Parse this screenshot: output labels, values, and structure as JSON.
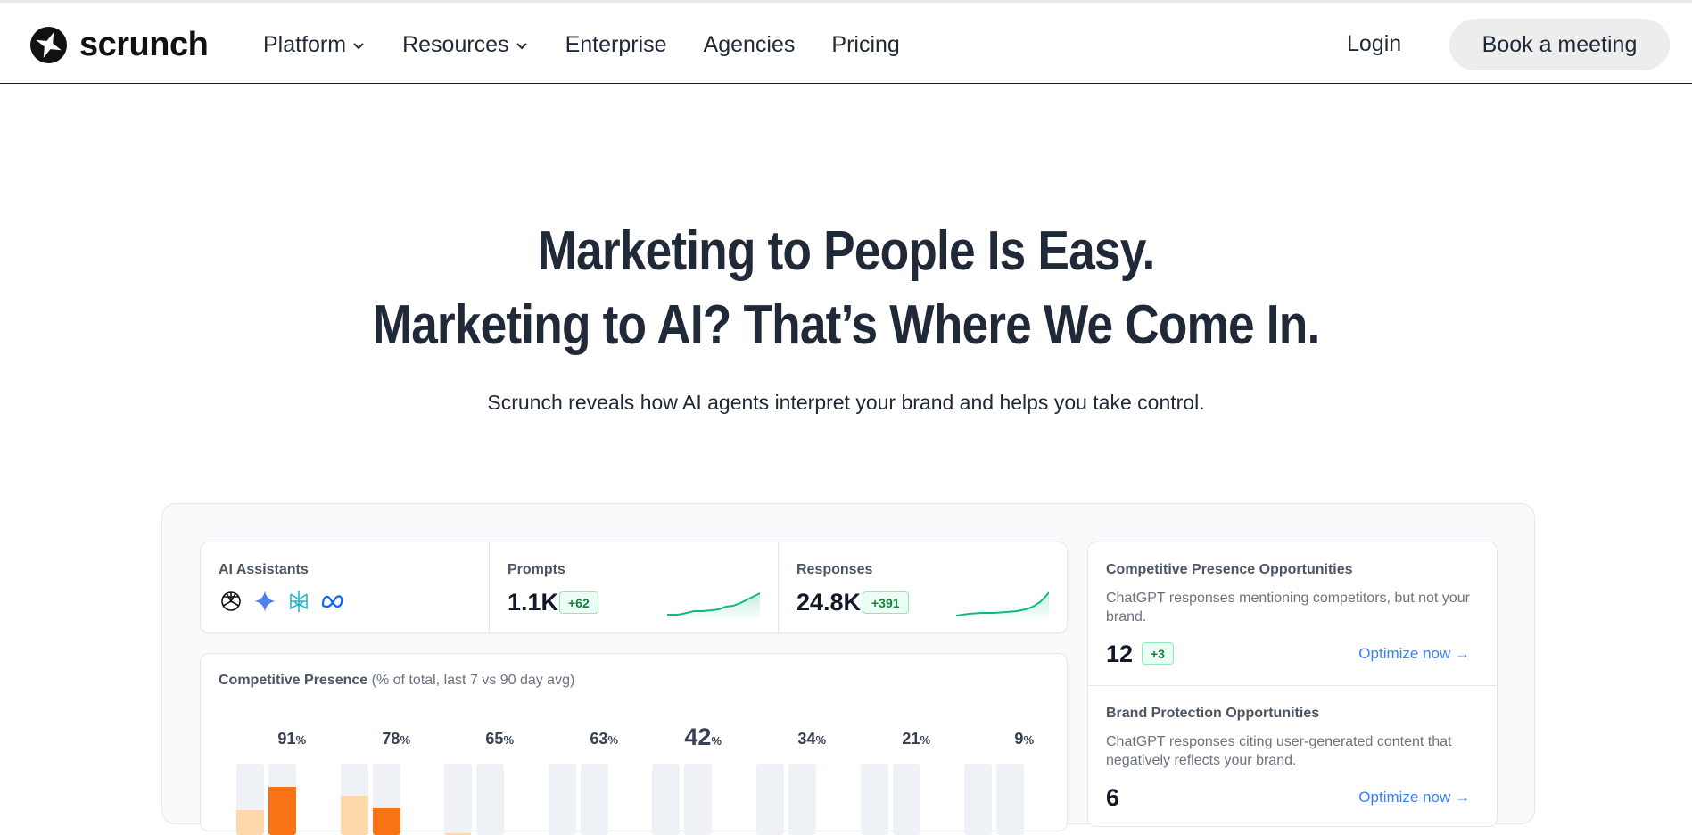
{
  "nav": {
    "logo_text": "scrunch",
    "links": [
      {
        "label": "Platform",
        "dropdown": true
      },
      {
        "label": "Resources",
        "dropdown": true
      },
      {
        "label": "Enterprise",
        "dropdown": false
      },
      {
        "label": "Agencies",
        "dropdown": false
      },
      {
        "label": "Pricing",
        "dropdown": false
      }
    ],
    "login_label": "Login",
    "cta_label": "Book a meeting"
  },
  "hero": {
    "line1": "Marketing to People Is Easy.",
    "line2": "Marketing to AI? That’s Where We Come In.",
    "subtitle": "Scrunch reveals how AI agents interpret your brand and helps you take control."
  },
  "dashboard": {
    "assistants": {
      "label": "AI Assistants",
      "icons": [
        "chatgpt-icon",
        "gemini-icon",
        "perplexity-icon",
        "meta-icon"
      ]
    },
    "prompts": {
      "label": "Prompts",
      "value": "1.1K",
      "delta": "+62"
    },
    "responses": {
      "label": "Responses",
      "value": "24.8K",
      "delta": "+391"
    },
    "competitive_presence": {
      "title": "Competitive Presence",
      "subtitle": "(% of total, last 7 vs 90 day avg)",
      "bars": [
        {
          "value": "91",
          "unit": "%"
        },
        {
          "value": "78",
          "unit": "%"
        },
        {
          "value": "65",
          "unit": "%"
        },
        {
          "value": "63",
          "unit": "%"
        },
        {
          "value": "42",
          "unit": "%"
        },
        {
          "value": "34",
          "unit": "%"
        },
        {
          "value": "21",
          "unit": "%"
        },
        {
          "value": "9",
          "unit": "%"
        }
      ]
    },
    "opportunities": [
      {
        "title": "Competitive Presence Opportunities",
        "description": "ChatGPT responses mentioning competitors, but not your brand.",
        "count": "12",
        "delta": "+3",
        "link": "Optimize now →"
      },
      {
        "title": "Brand Protection Opportunities",
        "description": "ChatGPT responses citing user-generated content that negatively reflects your brand.",
        "count": "6",
        "link": "Optimize now →"
      }
    ]
  },
  "colors": {
    "accent_orange": "#f97316",
    "light_orange": "#fed7aa",
    "green": "#10b981",
    "link_blue": "#3b82f6"
  }
}
